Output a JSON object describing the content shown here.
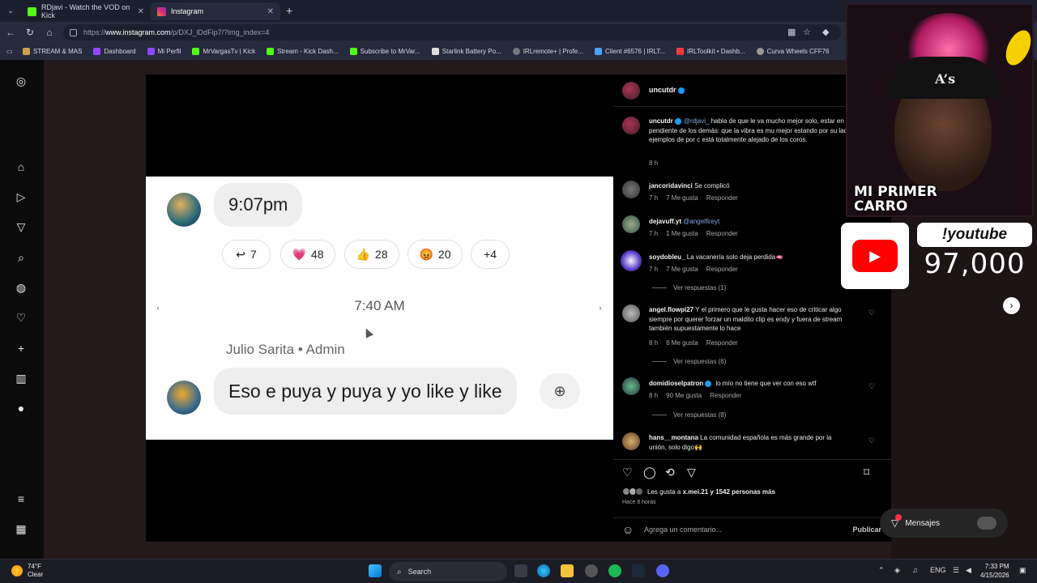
{
  "browser": {
    "tabs": [
      {
        "title": "RDjavi - Watch the VOD on Kick",
        "active": false,
        "icon_color": "#53fc18"
      },
      {
        "title": "Instagram",
        "active": true,
        "icon_color": "#e1306c"
      }
    ],
    "url_prefix": "https://",
    "url_domain": "www.instagram.com",
    "url_path": "/p/DXJ_lDdFip7/?img_index=4",
    "bookmarks": [
      {
        "label": "STREAM & MAS",
        "icon": "folder-icon"
      },
      {
        "label": "Dashboard",
        "icon": "twitch-icon"
      },
      {
        "label": "Mi Perfil",
        "icon": "twitch-icon"
      },
      {
        "label": "MrVargasTv | Kick",
        "icon": "kick-icon"
      },
      {
        "label": "Stream - Kick Dash...",
        "icon": "kick-icon"
      },
      {
        "label": "Subscribe to MrVar...",
        "icon": "kick-icon"
      },
      {
        "label": "Starlink Battery Po...",
        "icon": "page-icon"
      },
      {
        "label": "IRLremote+ | Profe...",
        "icon": "globe-icon"
      },
      {
        "label": "Client #6576 | IRLT...",
        "icon": "cloud-icon"
      },
      {
        "label": "IRLToolkit • Dashb...",
        "icon": "toolkit-icon"
      },
      {
        "label": "Curva Wheels CFF76",
        "icon": "wheel-icon"
      }
    ]
  },
  "post_image": {
    "time1": "9:07pm",
    "reactions1": [
      {
        "emoji": "↩",
        "count": "7"
      },
      {
        "emoji": "💗",
        "count": "48"
      },
      {
        "emoji": "👍",
        "count": "28"
      },
      {
        "emoji": "😡",
        "count": "20"
      },
      {
        "emoji": "",
        "count": "+4"
      }
    ],
    "time2": "7:40 AM",
    "author": "Julio Sarita • Admin",
    "message": "Eso e puya y puya y yo like y like"
  },
  "post": {
    "owner": "uncutdr",
    "caption_user": "uncutdr",
    "caption_mention": "@rdjavi_",
    "caption_text": "habla de que le va mucho mejor solo, estar en coro y pendiente de los demás: que la vibra es mu mejor estando por su lado, y da algunos ejemplos de por c está totalmente alejado de los coros.",
    "caption_age": "8 h",
    "comments": [
      {
        "user": "jancoridavinci",
        "text": "Se complicó",
        "mention": "",
        "age": "7 h",
        "likes": "7 Me gusta",
        "reply": "Responder",
        "replies": ""
      },
      {
        "user": "dejavuff.yt",
        "text": "",
        "mention": "@angelfireyt",
        "age": "7 h",
        "likes": "1 Me gusta",
        "reply": "Responder",
        "replies": ""
      },
      {
        "user": "soydobleu_",
        "text": "La vacanería solo deja perdida🫦",
        "mention": "",
        "age": "7 h",
        "likes": "7 Me gusta",
        "reply": "Responder",
        "replies": "Ver respuestas (1)"
      },
      {
        "user": "angel.flowpi27",
        "text": "Y el primero que le gusta hacer eso de criticar algo siempre por querer forzar un maldito clip es endy y fuera de stream también supuestamente lo hace",
        "mention": "",
        "age": "8 h",
        "likes": "6 Me gusta",
        "reply": "Responder",
        "replies": "Ver respuestas (6)"
      },
      {
        "user": "domidioselpatron",
        "text": "lo mío no tiene que ver con eso wtf",
        "mention": "",
        "age": "8 h",
        "likes": "90 Me gusta",
        "reply": "Responder",
        "replies": "Ver respuestas (8)"
      },
      {
        "user": "hans__montana",
        "text": "La comunidad española es más grande por la unión, solo digo🙌",
        "mention": "",
        "age": "",
        "likes": "",
        "reply": "",
        "replies": ""
      }
    ],
    "liked_by_prefix": "Les gusta a",
    "liked_by_user": "x.mei.21",
    "liked_by_suffix": "y 1542 personas más",
    "posted_ago": "Hace 8 horas",
    "add_comment_placeholder": "Agrega un comentario...",
    "publish_label": "Publicar"
  },
  "messages_label": "Mensajes",
  "overlay": {
    "carro_line1": "MI PRIMER",
    "carro_line2": "CARRO",
    "youtube_cmd": "!youtube",
    "youtube_count": "97,000"
  },
  "taskbar": {
    "temp": "74°F",
    "condition": "Clear",
    "search": "Search",
    "lang": "ENG",
    "time": "7:33 PM",
    "date": "4/15/2026"
  }
}
